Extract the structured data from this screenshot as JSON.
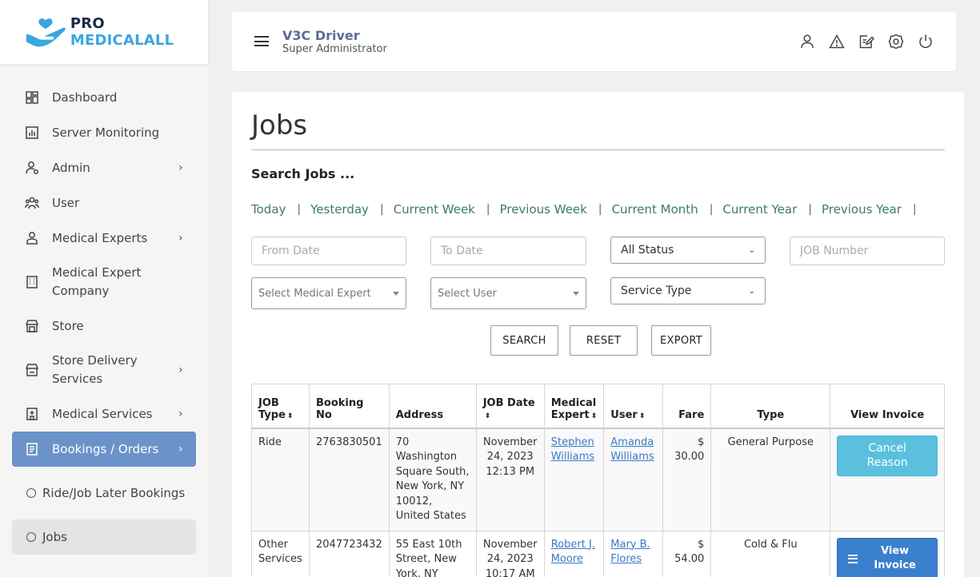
{
  "brand": {
    "pro": "PRO",
    "med": "MEDICALALL",
    "colors": {
      "dark": "#1c2a4a",
      "accent": "#3aa6df"
    }
  },
  "sidebar": {
    "items": [
      {
        "label": "Dashboard",
        "icon": "dashboard-icon",
        "chevron": ""
      },
      {
        "label": "Server Monitoring",
        "icon": "chart-icon",
        "chevron": ""
      },
      {
        "label": "Admin",
        "icon": "admin-icon",
        "chevron": "›"
      },
      {
        "label": "User",
        "icon": "users-icon",
        "chevron": ""
      },
      {
        "label": "Medical Experts",
        "icon": "person-icon",
        "chevron": "›"
      },
      {
        "label": "Medical Expert Company",
        "icon": "building-icon",
        "chevron": ""
      },
      {
        "label": "Store",
        "icon": "store-icon",
        "chevron": ""
      },
      {
        "label": "Store Delivery Services",
        "icon": "store-delivery-icon",
        "chevron": "›"
      },
      {
        "label": "Medical Services",
        "icon": "hospital-icon",
        "chevron": "›"
      },
      {
        "label": "Bookings / Orders",
        "icon": "orders-icon",
        "chevron": "›"
      }
    ],
    "subitems": [
      {
        "label": "Ride/Job Later Bookings"
      },
      {
        "label": "Jobs"
      }
    ],
    "active_color": "#6b93c9"
  },
  "header": {
    "title": "V3C Driver",
    "subtitle": "Super Administrator"
  },
  "page": {
    "title": "Jobs",
    "search_heading": "Search Jobs ...",
    "quick_filters": [
      "Today",
      "Yesterday",
      "Current Week",
      "Previous Week",
      "Current Month",
      "Current Year",
      "Previous Year"
    ],
    "from_date_placeholder": "From Date",
    "to_date_placeholder": "To Date",
    "status_value": "All Status",
    "job_number_placeholder": "JOB Number",
    "medical_expert_placeholder": "Select Medical Expert",
    "user_placeholder": "Select User",
    "service_type_value": "Service Type",
    "buttons": {
      "search": "SEARCH",
      "reset": "RESET",
      "export": "EXPORT"
    }
  },
  "table": {
    "headers": {
      "job_type_1": "JOB",
      "job_type_2": "Type",
      "booking_no": "Booking No",
      "address": "Address",
      "job_date_1": "JOB Date",
      "expert_1": "Medical",
      "expert_2": "Expert",
      "user": "User",
      "fare": "Fare",
      "type": "Type",
      "invoice": "View Invoice"
    },
    "sort_glyph": "⬍",
    "rows": [
      {
        "job_type": "Ride",
        "booking_no": "2763830501",
        "address": "70 Washington Square South, New York, NY 10012, United States",
        "job_date": "November 24, 2023 12:13 PM",
        "expert": "Stephen Williams",
        "user": "Amanda Williams",
        "fare": "$ 30.00",
        "type": "General Purpose",
        "action": "Cancel Reason"
      },
      {
        "job_type": "Other Services",
        "booking_no": "2047723432",
        "address": "55 East 10th Street, New York, NY",
        "job_date": "November 24, 2023 10:17 AM",
        "expert": "Robert J. Moore",
        "user": "Mary B. Flores",
        "fare": "$ 54.00",
        "type": "Cold & Flu",
        "action": "View Invoice"
      }
    ]
  }
}
